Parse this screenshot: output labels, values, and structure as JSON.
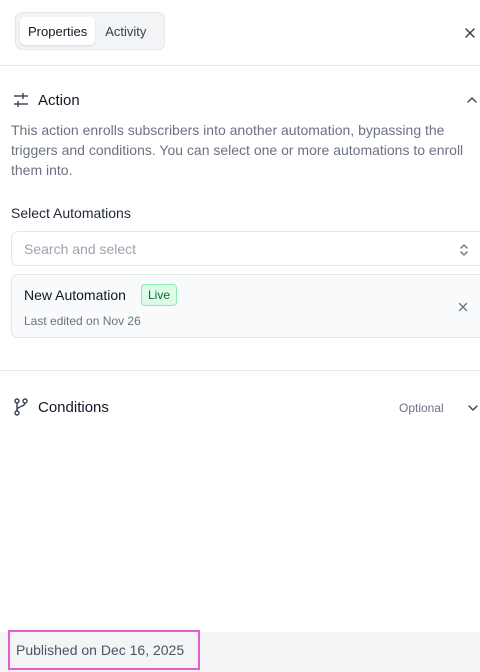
{
  "tabs": [
    {
      "label": "Properties",
      "active": true
    },
    {
      "label": "Activity",
      "active": false
    }
  ],
  "action": {
    "title": "Action",
    "description": "This action enrolls subscribers into another automation, bypassing the triggers and conditions. You can select one or more automations to enroll them into."
  },
  "select_automations": {
    "label": "Select Automations",
    "placeholder": "Search and select"
  },
  "automation_card": {
    "name": "New Automation",
    "status": "Live",
    "last_edited": "Last edited on Nov 26"
  },
  "conditions": {
    "title": "Conditions",
    "optional_label": "Optional"
  },
  "footer": {
    "published": "Published on Dec 16, 2025"
  },
  "colors": {
    "live_badge_bg": "#dcfce7",
    "live_badge_text": "#166534",
    "highlight_border": "#e35cd0"
  },
  "icons": [
    "close-icon",
    "sliders-icon",
    "chevron-up-icon",
    "chevron-up-down-icon",
    "branch-icon",
    "chevron-down-icon"
  ]
}
